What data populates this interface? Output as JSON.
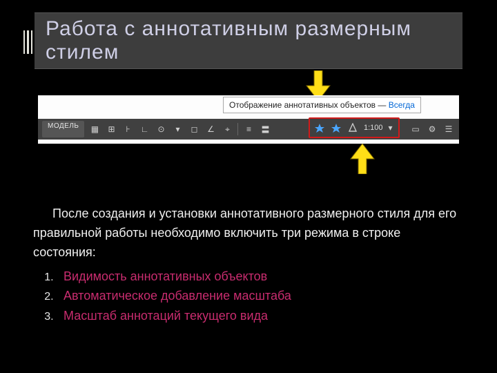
{
  "title": "Работа  с  аннотативным  размерным  стилем",
  "statusbar": {
    "model_label": "МОДЕЛЬ",
    "tooltip_label": "Отображение аннотативных объектов —",
    "tooltip_value": "Всегда",
    "scale": "1:100"
  },
  "body": {
    "paragraph": "После создания и установки аннотативного размерного стиля для его правильной работы необходимо включить три режима в строке состояния:",
    "items": [
      "Видимость аннотативных объектов",
      "Автоматическое добавление масштаба",
      "Масштаб аннотаций текущего вида"
    ]
  }
}
